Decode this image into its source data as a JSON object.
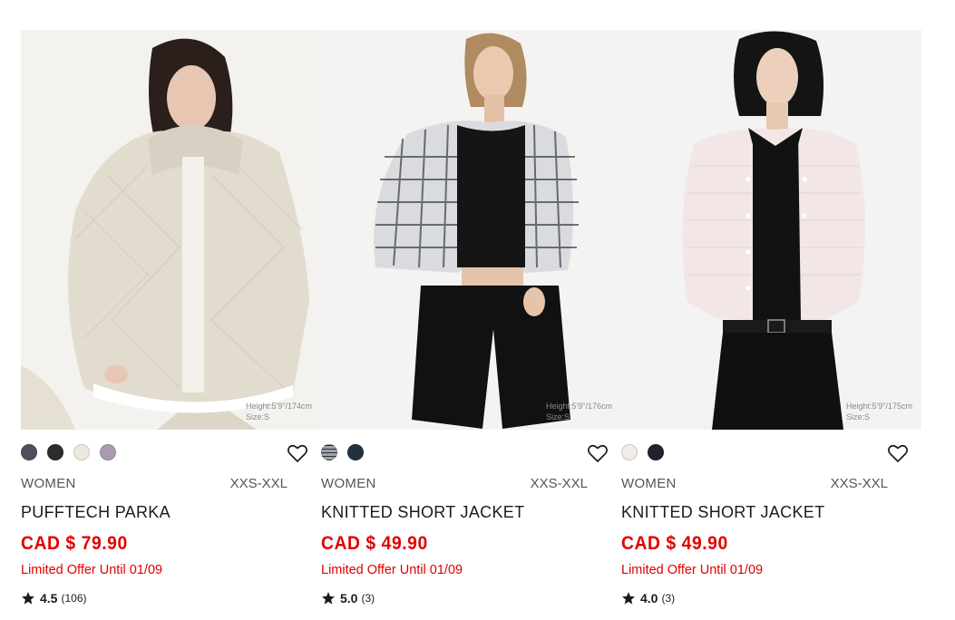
{
  "products": [
    {
      "gender": "WOMEN",
      "sizes": "XXS-XXL",
      "name": "PUFFTECH PARKA",
      "price": "CAD $ 79.90",
      "offer": "Limited Offer Until 01/09",
      "rating": "4.5",
      "review_count": "(106)",
      "model_height": "Height:5'9\"/174cm",
      "model_size": "Size:S",
      "swatch_colors": [
        "#4d4f5c",
        "#2c2c2e",
        "#ece8dd",
        "#a99aae"
      ],
      "favorite_icon": "heart-outline-icon"
    },
    {
      "gender": "WOMEN",
      "sizes": "XXS-XXL",
      "name": "KNITTED SHORT JACKET",
      "price": "CAD $ 49.90",
      "offer": "Limited Offer Until 01/09",
      "rating": "5.0",
      "review_count": "(3)",
      "model_height": "Height:5'9\"/176cm",
      "model_size": "Size:S",
      "swatch_colors": [
        "#c9cbd0",
        "#223140"
      ],
      "favorite_icon": "heart-outline-icon"
    },
    {
      "gender": "WOMEN",
      "sizes": "XXS-XXL",
      "name": "KNITTED SHORT JACKET",
      "price": "CAD $ 49.90",
      "offer": "Limited Offer Until 01/09",
      "rating": "4.0",
      "review_count": "(3)",
      "model_height": "Height:5'9\"/175cm",
      "model_size": "Size:S",
      "swatch_colors": [
        "#f2ece6",
        "#1f232c"
      ],
      "favorite_icon": "heart-outline-icon"
    }
  ],
  "colors": {
    "price_red": "#e00000",
    "text_dark": "#1b1b1b",
    "text_muted": "#555555"
  }
}
